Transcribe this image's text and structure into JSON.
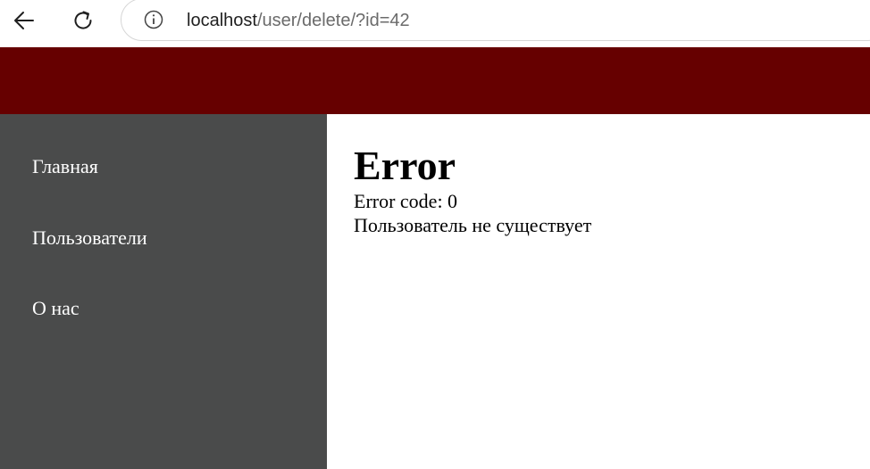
{
  "browser": {
    "url_host": "localhost",
    "url_path": "/user/delete/?id=42",
    "icons": {
      "back": "arrow-left-icon",
      "reload": "reload-icon",
      "info": "info-icon"
    }
  },
  "colors": {
    "header": "#660000",
    "sidebar": "#4a4b4b",
    "sidebar_text": "#ffffff",
    "main_background": "#ffffff"
  },
  "sidebar": {
    "items": [
      {
        "label": "Главная"
      },
      {
        "label": "Пользователи"
      },
      {
        "label": "О нас"
      }
    ]
  },
  "main": {
    "title": "Error",
    "error_code": "Error code: 0",
    "message": "Пользователь не существует"
  }
}
